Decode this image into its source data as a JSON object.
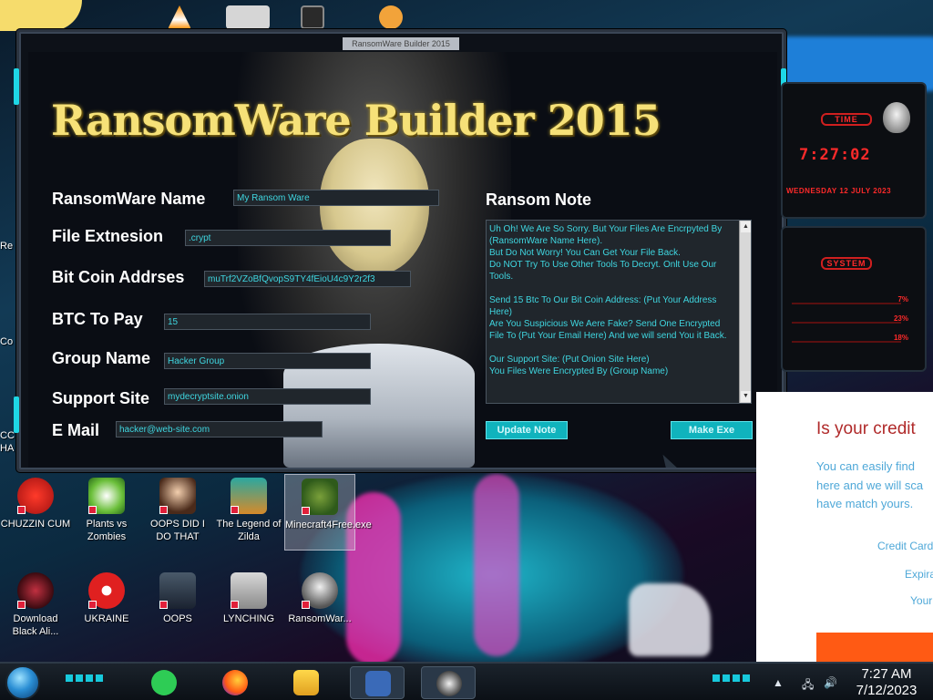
{
  "window": {
    "title": "RansomWare Builder 2015",
    "brand": "RansomWare Builder 2015"
  },
  "form": {
    "ransomware_name": {
      "label": "RansomWare Name",
      "value": "My Ransom Ware"
    },
    "file_extension": {
      "label": "File Extnesion",
      "value": ".crypt"
    },
    "bitcoin_address": {
      "label": "Bit Coin Addrses",
      "value": "muTrf2VZoBfQvopS9TY4fEioU4c9Y2r2f3"
    },
    "btc_to_pay": {
      "label": "BTC To Pay",
      "value": "15"
    },
    "group_name": {
      "label": "Group Name",
      "value": "Hacker Group"
    },
    "support_site": {
      "label": "Support Site",
      "value": "mydecryptsite.onion"
    },
    "email": {
      "label": "E Mail",
      "value": "hacker@web-site.com"
    }
  },
  "ransom_note": {
    "label": "Ransom Note",
    "text": "Uh Oh! We Are So Sorry. But Your Files Are Encrpyted By (RansomWare Name Here).\nBut Do Not Worry! You Can Get Your File Back.\nDo NOT Try To Use Other Tools To Decryt. Onlt Use Our Tools.\n\nSend 15 Btc To Our Bit Coin Address: (Put Your Address Here)\nAre You Suspicious We Aere Fake? Send One Encrypted File To (Put Your Email Here) And we will send You it Back.\n\nOur Support Site: (Put Onion Site Here)\nYou Files Were Encrypted By (Group Name)"
  },
  "buttons": {
    "update_note": "Update Note",
    "make_exe": "Make Exe"
  },
  "gadgets": {
    "time_title": "TIME",
    "time_value": "7:27:02",
    "date_value": "WEDNESDAY 12 JULY 2023",
    "system_title": "SYSTEM",
    "cpu": "7%",
    "ram": "23%",
    "disk": "18%"
  },
  "web_popup": {
    "title": "Is your credit",
    "line1": "You can easily find",
    "line2": "here and we will sca",
    "line3": "have match yours.",
    "field1": "Credit Card",
    "field2": "Expira",
    "field3": "Your"
  },
  "desktop_icons": [
    {
      "label": "CHUZZIN CUM"
    },
    {
      "label": "Plants vs Zombies"
    },
    {
      "label": "OOPS DID I DO THAT"
    },
    {
      "label": "The Legend of Zilda"
    },
    {
      "label": "Minecraft4Free.exe"
    },
    {
      "label": "Download Black Ali..."
    },
    {
      "label": "UKRAINE"
    },
    {
      "label": "OOPS"
    },
    {
      "label": "LYNCHING"
    },
    {
      "label": "RansomWar..."
    }
  ],
  "left_cut_labels": {
    "a": "Re",
    "b": "Co",
    "c": "CC",
    "d": "HA"
  },
  "taskbar": {
    "time": "7:27 AM",
    "date": "7/12/2023"
  },
  "colors": {
    "accent": "#1ed7e6",
    "field_text": "#3fd6e0",
    "title_gold": "#f6e178",
    "gadget_red": "#ff2a2a"
  }
}
